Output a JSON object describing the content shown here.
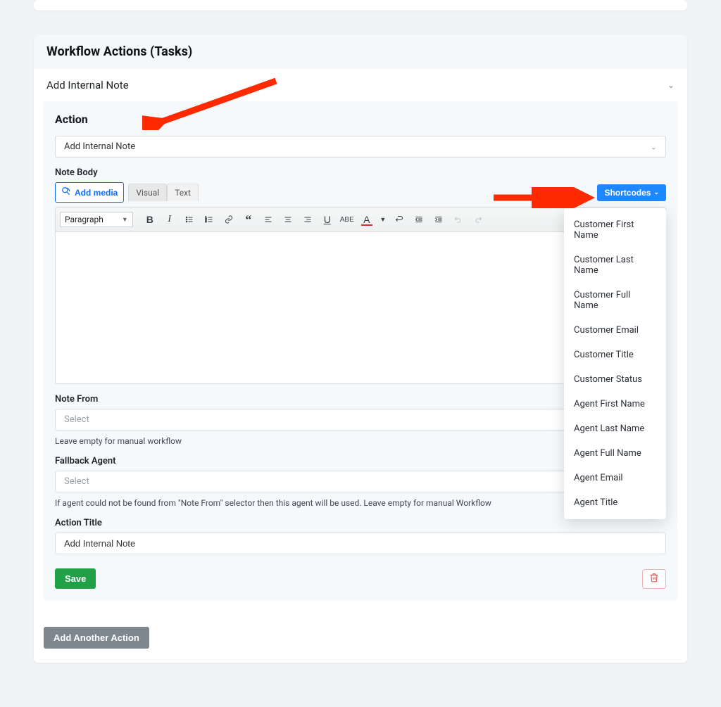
{
  "header": {
    "title": "Workflow Actions (Tasks)"
  },
  "section": {
    "title": "Add Internal Note",
    "action_heading": "Action",
    "action_select": "Add Internal Note",
    "note_body_label": "Note Body",
    "add_media": "Add media",
    "tab_visual": "Visual",
    "tab_text": "Text",
    "shortcodes_btn": "Shortcodes",
    "format_select": "Paragraph",
    "note_from_label": "Note From",
    "note_from_placeholder": "Select",
    "note_from_help": "Leave empty for manual workflow",
    "fallback_label": "Fallback Agent",
    "fallback_placeholder": "Select",
    "fallback_help": "If agent could not be found from \"Note From\" selector then this agent will be used. Leave empty for manual Workflow",
    "action_title_label": "Action Title",
    "action_title_value": "Add Internal Note",
    "save": "Save"
  },
  "shortcodes": [
    "Customer First Name",
    "Customer Last Name",
    "Customer Full Name",
    "Customer Email",
    "Customer Title",
    "Customer Status",
    "Agent First Name",
    "Agent Last Name",
    "Agent Full Name",
    "Agent Email",
    "Agent Title"
  ],
  "add_another": "Add Another Action"
}
